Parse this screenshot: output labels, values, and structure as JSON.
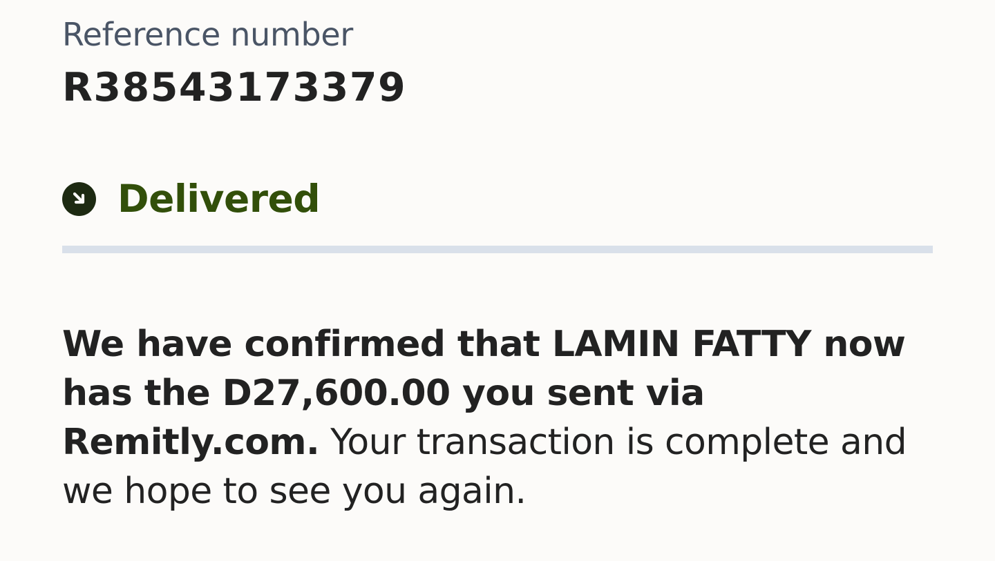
{
  "reference": {
    "label": "Reference number",
    "value": "R38543173379"
  },
  "status": {
    "icon": "arrow-down-right-circle-icon",
    "label": "Delivered",
    "color": "#324f0a"
  },
  "message": {
    "strong_text": "We have confirmed that LAMIN FATTY now has the D27,600.00 you sent via Remitly.com.",
    "regular_text": "Your transaction is complete and we hope to see you again."
  },
  "colors": {
    "background": "#fcfbf9",
    "label": "#4a5566",
    "text": "#222222",
    "status_icon": "#1d2a12",
    "divider": "#d9e0ea"
  }
}
